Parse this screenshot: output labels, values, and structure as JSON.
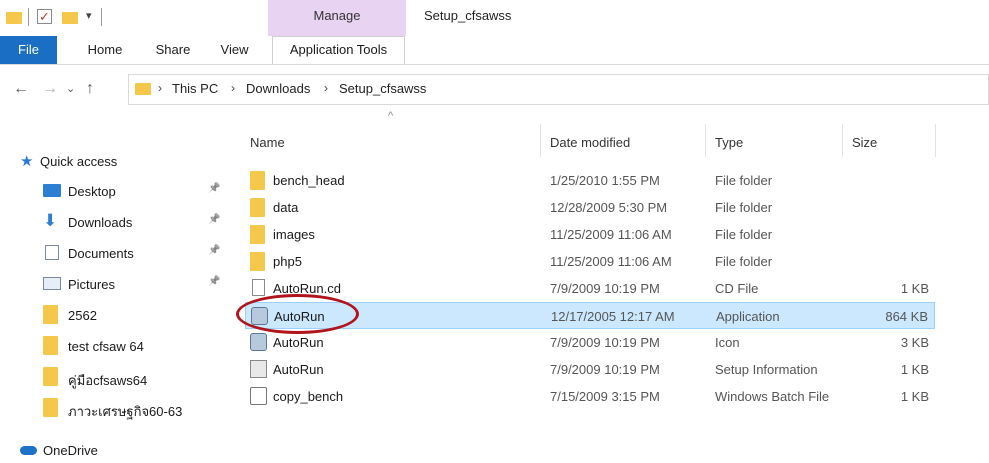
{
  "window": {
    "title": "Setup_cfsawss",
    "context_tab": "Manage"
  },
  "ribbon": {
    "tabs": [
      "File",
      "Home",
      "Share",
      "View",
      "Application Tools"
    ]
  },
  "address": {
    "crumbs": [
      "This PC",
      "Downloads",
      "Setup_cfsawss"
    ]
  },
  "columns": {
    "name": "Name",
    "date": "Date modified",
    "type": "Type",
    "size": "Size"
  },
  "nav_pane": {
    "quick_access": "Quick access",
    "items": [
      {
        "label": "Desktop",
        "icon": "desktop-icon",
        "pinned": true
      },
      {
        "label": "Downloads",
        "icon": "download-arrow-icon",
        "pinned": true
      },
      {
        "label": "Documents",
        "icon": "document-icon",
        "pinned": true
      },
      {
        "label": "Pictures",
        "icon": "pictures-icon",
        "pinned": true
      },
      {
        "label": "2562",
        "icon": "folder-icon",
        "pinned": false
      },
      {
        "label": "test cfsaw 64",
        "icon": "folder-icon",
        "pinned": false
      },
      {
        "label": "คู่มือcfsaws64",
        "icon": "folder-icon",
        "pinned": false
      },
      {
        "label": "ภาวะเศรษฐกิจ60-63",
        "icon": "folder-icon",
        "pinned": false
      }
    ],
    "onedrive": "OneDrive"
  },
  "files": [
    {
      "name": "bench_head",
      "date": "1/25/2010 1:55 PM",
      "type": "File folder",
      "size": "",
      "icon": "folder-icon"
    },
    {
      "name": "data",
      "date": "12/28/2009 5:30 PM",
      "type": "File folder",
      "size": "",
      "icon": "folder-icon"
    },
    {
      "name": "images",
      "date": "11/25/2009 11:06 AM",
      "type": "File folder",
      "size": "",
      "icon": "folder-icon"
    },
    {
      "name": "php5",
      "date": "11/25/2009 11:06 AM",
      "type": "File folder",
      "size": "",
      "icon": "folder-icon"
    },
    {
      "name": "AutoRun.cd",
      "date": "7/9/2009 10:19 PM",
      "type": "CD File",
      "size": "1 KB",
      "icon": "file-icon"
    },
    {
      "name": "AutoRun",
      "date": "12/17/2005 12:17 AM",
      "type": "Application",
      "size": "864 KB",
      "icon": "application-icon",
      "selected": true
    },
    {
      "name": "AutoRun",
      "date": "7/9/2009 10:19 PM",
      "type": "Icon",
      "size": "3 KB",
      "icon": "icon-file-icon"
    },
    {
      "name": "AutoRun",
      "date": "7/9/2009 10:19 PM",
      "type": "Setup Information",
      "size": "1 KB",
      "icon": "setup-info-icon"
    },
    {
      "name": "copy_bench",
      "date": "7/15/2009 3:15 PM",
      "type": "Windows Batch File",
      "size": "1 KB",
      "icon": "batch-file-icon"
    }
  ],
  "colors": {
    "file_tab": "#1a6fc4",
    "manage_tab": "#e9d3f2",
    "selection": "#cce8ff",
    "highlight_oval": "#b0141c"
  }
}
